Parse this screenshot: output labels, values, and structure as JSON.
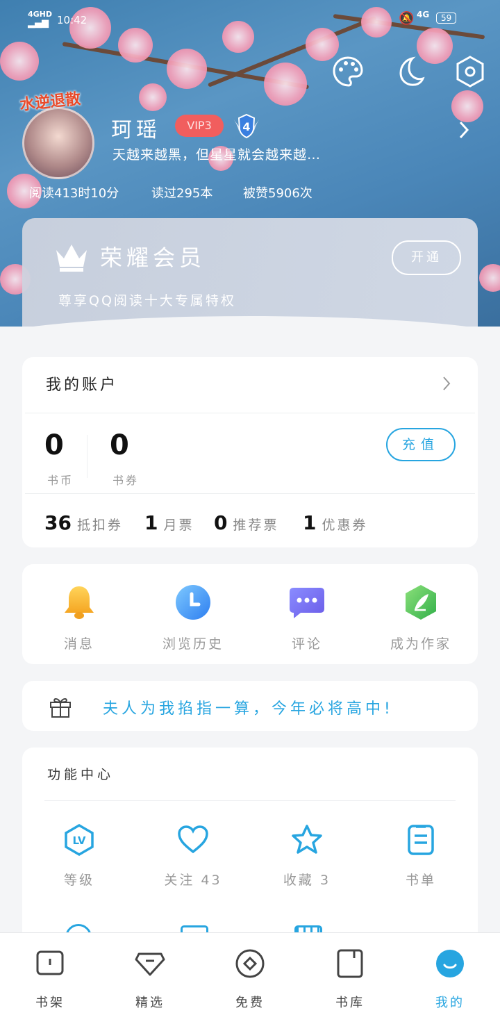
{
  "status_bar": {
    "network": "4GHD",
    "time": "10:42",
    "right_network": "4G",
    "battery": "59"
  },
  "profile": {
    "avatar_badge": "水逆退散",
    "username": "珂瑶",
    "vip": "VIP3",
    "level": "4",
    "signature": "天越来越黑，但星星就会越来越…",
    "stats": [
      "阅读413时10分",
      "读过295本",
      "被赞5906次"
    ]
  },
  "member": {
    "title": "荣耀会员",
    "subtitle": "尊享QQ阅读十大专属特权",
    "button": "开通"
  },
  "account": {
    "title": "我的账户",
    "coins_value": "0",
    "coins_label": "书币",
    "vouchers_value": "0",
    "vouchers_label": "书券",
    "recharge": "充值",
    "tickets": [
      {
        "num": "36",
        "label": "抵扣券"
      },
      {
        "num": "1",
        "label": "月票"
      },
      {
        "num": "0",
        "label": "推荐票"
      },
      {
        "num": "1",
        "label": "优惠券"
      }
    ]
  },
  "quick_actions": [
    {
      "label": "消息",
      "icon": "bell-icon"
    },
    {
      "label": "浏览历史",
      "icon": "clock-icon"
    },
    {
      "label": "评论",
      "icon": "chat-icon"
    },
    {
      "label": "成为作家",
      "icon": "quill-icon"
    }
  ],
  "banner": {
    "text": "夫人为我掐指一算，今年必将高中!"
  },
  "function_center": {
    "title": "功能中心",
    "items": [
      {
        "label": "等级",
        "icon": "level-icon"
      },
      {
        "label": "关注 43",
        "icon": "heart-icon"
      },
      {
        "label": "收藏 3",
        "icon": "star-icon"
      },
      {
        "label": "书单",
        "icon": "booklist-icon"
      }
    ]
  },
  "tabs": [
    {
      "label": "书架",
      "icon": "bookshelf-icon"
    },
    {
      "label": "精选",
      "icon": "featured-icon"
    },
    {
      "label": "免费",
      "icon": "free-icon"
    },
    {
      "label": "书库",
      "icon": "library-icon"
    },
    {
      "label": "我的",
      "icon": "profile-icon",
      "active": true
    }
  ],
  "colors": {
    "accent": "#27a5e0",
    "vip_badge": "#f15e5e",
    "header_blue": "#4a86b8"
  }
}
